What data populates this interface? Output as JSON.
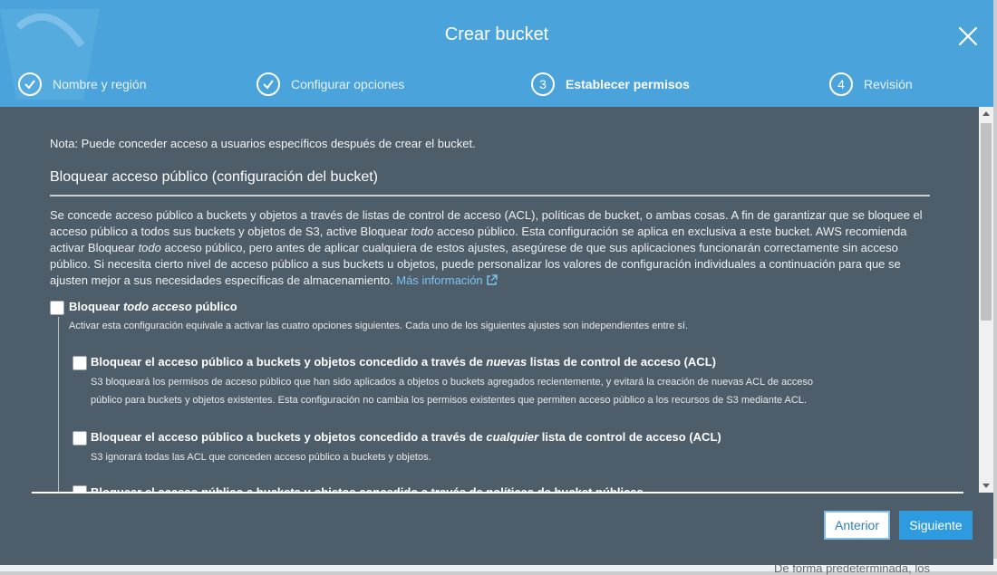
{
  "background": {
    "peek_text": "De forma predeterminada, los"
  },
  "modal": {
    "title": "Crear bucket",
    "close_icon": "close-icon",
    "steps": [
      {
        "number": "1",
        "label": "Nombre y región",
        "state": "done",
        "icon": "check-icon"
      },
      {
        "number": "2",
        "label": "Configurar opciones",
        "state": "done",
        "icon": "check-icon"
      },
      {
        "number": "3",
        "label": "Establecer permisos",
        "state": "active"
      },
      {
        "number": "4",
        "label": "Revisión",
        "state": "pending"
      }
    ]
  },
  "content": {
    "note": "Nota: Puede conceder acceso a usuarios específicos después de crear el bucket.",
    "section_title": "Bloquear acceso público (configuración del bucket)",
    "description_parts": {
      "p1": "Se concede acceso público a buckets y objetos a través de listas de control de acceso (ACL), políticas de bucket, o ambas cosas. A fin de garantizar que se bloquee el acceso público a todos sus buckets y objetos de S3, active Bloquear ",
      "em1": "todo",
      "p2": " acceso público. Esta configuración se aplica en exclusiva a este bucket. AWS recomienda activar Bloquear ",
      "em2": "todo",
      "p3": " acceso público, pero antes de aplicar cualquiera de estos ajustes, asegúrese de que sus aplicaciones funcionarán correctamente sin acceso público. Si necesita cierto nivel de acceso público a sus buckets u objetos, puede personalizar los valores de configuración individuales a continuación para que se ajusten mejor a sus necesidades específicas de almacenamiento. ",
      "link": "Más información",
      "link_icon": "external-link-icon"
    },
    "block_all": {
      "label_a": "Bloquear ",
      "label_em": "todo acceso",
      "label_b": " público",
      "checked": false,
      "help": "Activar esta configuración equivale a activar las cuatro opciones siguientes. Cada uno de los siguientes ajustes son independientes entre sí."
    },
    "options": [
      {
        "label_a": "Bloquear el acceso público a buckets y objetos concedido a través de ",
        "label_em": "nuevas",
        "label_b": " listas de control de acceso (ACL)",
        "checked": false,
        "help_1": "S3 bloqueará los permisos de acceso público que han sido aplicados a objetos o buckets agregados recientemente, y evitará la creación de nuevas ACL de acceso",
        "help_2": "público para buckets y objetos existentes. Esta configuración no cambia los permisos existentes que permiten acceso público a los recursos de S3 mediante ACL."
      },
      {
        "label_a": "Bloquear el acceso público a buckets y objetos concedido a través de ",
        "label_em": "cualquier",
        "label_b": " lista de control de acceso (ACL)",
        "checked": false,
        "help_1": "S3 ignorará todas las ACL que conceden acceso público a buckets y objetos."
      },
      {
        "label": "Bloquear el acceso público a buckets y objetos concedido a través de políticas de bucket públicas",
        "checked": false
      }
    ]
  },
  "footer": {
    "prev_label": "Anterior",
    "next_label": "Siguiente"
  },
  "colors": {
    "header": "#4aa3da",
    "body": "#4e5d6a",
    "link": "#7ec3f0",
    "primary_button": "#2e9be0"
  }
}
